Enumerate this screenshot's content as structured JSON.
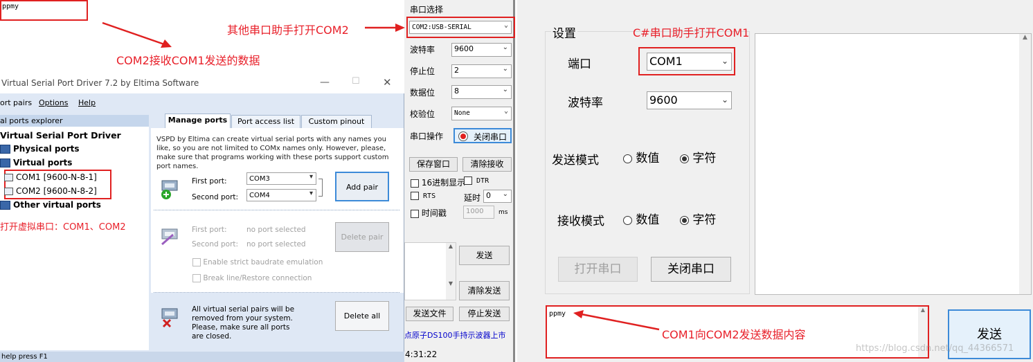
{
  "top_left": {
    "received_text": "ppmy",
    "annotation": "COM2接收COM1发送的数据"
  },
  "annotations": {
    "other_assistant": "其他串口助手打开COM2",
    "csharp_assistant": "C#串口助手打开COM1",
    "send_content": "COM1向COM2发送数据内容",
    "virtual_ports": "打开虚拟串口：COM1、COM2",
    "watermark": "https://blog.csdn.net/qq_44366571"
  },
  "vspd": {
    "title": "Virtual Serial Port Driver 7.2 by Eltima Software",
    "menu": [
      "ort pairs",
      "Options",
      "Help"
    ],
    "explorer_header": "al ports explorer",
    "tree": {
      "root": "Virtual Serial Port Driver",
      "physical": "Physical ports",
      "virtual": "Virtual ports",
      "com1": "COM1 [9600-N-8-1]",
      "com2": "COM2 [9600-N-8-2]",
      "other": "Other virtual ports"
    },
    "tabs": [
      "Manage ports",
      "Port access list",
      "Custom pinout"
    ],
    "description": "VSPD by Eltima can create virtual serial ports with any names you like, so you are not limited to COMx names only. However, please, make sure that programs working with these ports support custom port names.",
    "first_port_label": "First port:",
    "first_port_value": "COM3",
    "second_port_label": "Second port:",
    "second_port_value": "COM4",
    "add_pair": "Add pair",
    "first_port_label2": "First port:",
    "second_port_label2": "Second port:",
    "no_port": "no port selected",
    "delete_pair": "Delete pair",
    "strict_baud": "Enable strict baudrate emulation",
    "break_line": "Break line/Restore connection",
    "delete_all_text": "All virtual serial pairs will be removed from your system. Please, make sure all ports are closed.",
    "delete_all": "Delete all",
    "status": "help press F1"
  },
  "mid_panel": {
    "port_select_label": "串口选择",
    "port_select_value": "COM2:USB-SERIAL",
    "baud_label": "波特率",
    "baud_value": "9600",
    "stop_label": "停止位",
    "stop_value": "2",
    "data_label": "数据位",
    "data_value": "8",
    "parity_label": "校验位",
    "parity_value": "None",
    "op_label": "串口操作",
    "close_port": "关闭串口",
    "save_window": "保存窗口",
    "clear_recv": "清除接收",
    "hex_display": "16进制显示",
    "dtr": "DTR",
    "rts": "RTS",
    "delay_label": "延时",
    "delay_value": "0",
    "timestamp": "时间戳",
    "interval_value": "1000",
    "ms": "ms",
    "send": "发送",
    "clear_send": "清除发送",
    "send_file": "发送文件",
    "stop_send": "停止发送",
    "ad_text": "点原子DS100手持示波器上市",
    "clock": "4:31:22"
  },
  "csharp": {
    "settings_group": "设置",
    "port_label": "端口",
    "port_value": "COM1",
    "baud_label": "波特率",
    "baud_value": "9600",
    "send_mode_label": "发送模式",
    "recv_mode_label": "接收模式",
    "opt_numeric": "数值",
    "opt_char": "字符",
    "open_port": "打开串口",
    "close_port": "关闭串口",
    "send_text": "ppmy",
    "send_button": "发送"
  },
  "colors": {
    "annotation_red": "#e8202a",
    "vspd_titlebar": "#ffffff",
    "vspd_panel": "#dfe8f5"
  }
}
